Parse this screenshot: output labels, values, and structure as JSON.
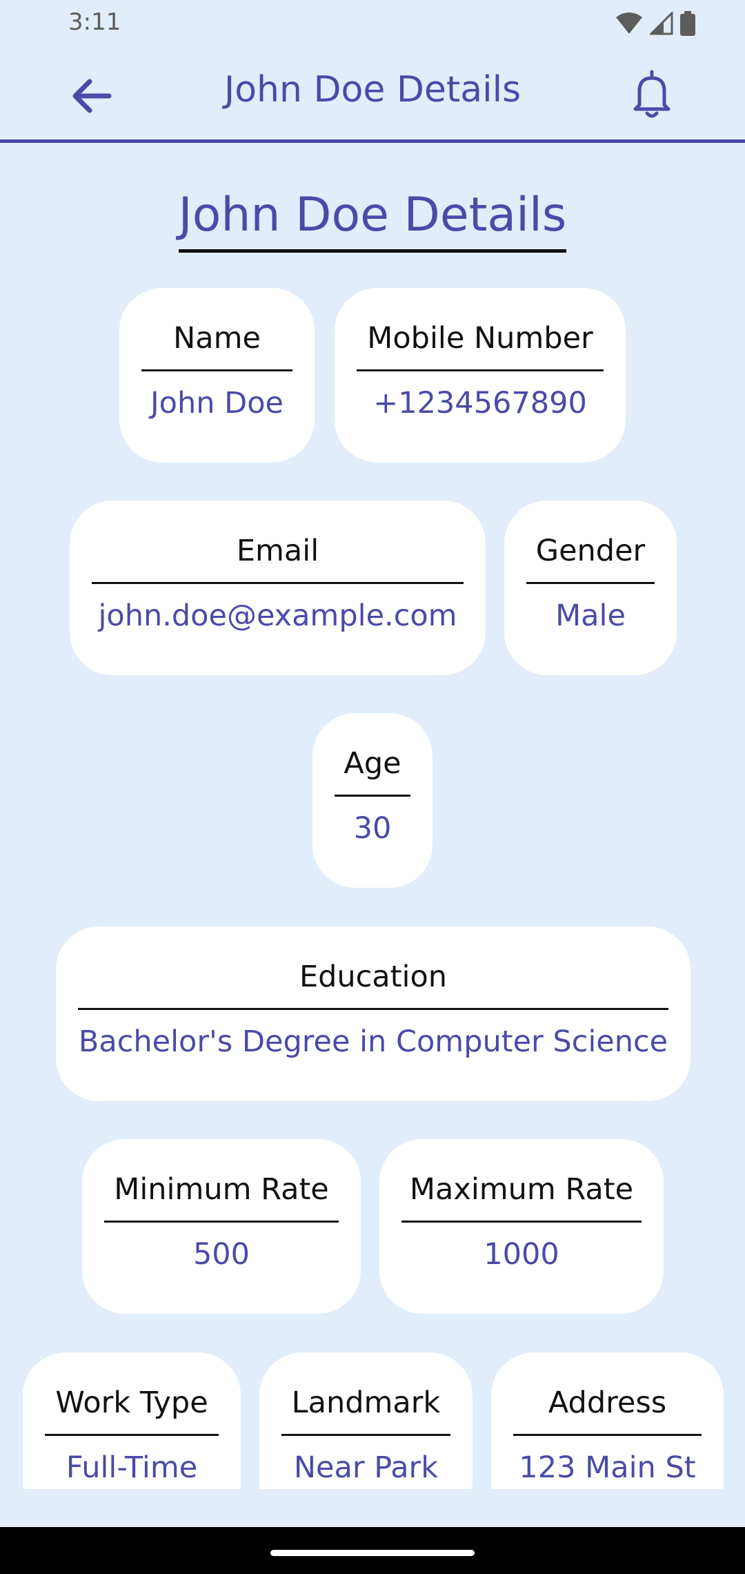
{
  "status_bar": {
    "time": "3:11"
  },
  "app_bar": {
    "title": "John Doe Details"
  },
  "page": {
    "title": "John Doe Details"
  },
  "fields": {
    "name": {
      "label": "Name",
      "value": "John Doe"
    },
    "mobile": {
      "label": "Mobile Number",
      "value": "+1234567890"
    },
    "email": {
      "label": "Email",
      "value": "john.doe@example.com"
    },
    "gender": {
      "label": "Gender",
      "value": "Male"
    },
    "age": {
      "label": "Age",
      "value": "30"
    },
    "education": {
      "label": "Education",
      "value": "Bachelor's Degree in Computer Science"
    },
    "min_rate": {
      "label": "Minimum Rate",
      "value": "500"
    },
    "max_rate": {
      "label": "Maximum Rate",
      "value": "1000"
    },
    "work_type": {
      "label": "Work Type",
      "value": "Full-Time"
    },
    "landmark": {
      "label": "Landmark",
      "value": "Near Park"
    },
    "address": {
      "label": "Address",
      "value": "123 Main St"
    }
  },
  "icons": {
    "back": "arrow-back-icon",
    "notifications": "bell-icon",
    "wifi": "wifi-icon",
    "signal": "cellular-signal-icon",
    "battery": "battery-icon"
  },
  "colors": {
    "accent": "#4a4aa8",
    "background": "#e1edfb",
    "card": "#ffffff",
    "label": "#111111"
  }
}
